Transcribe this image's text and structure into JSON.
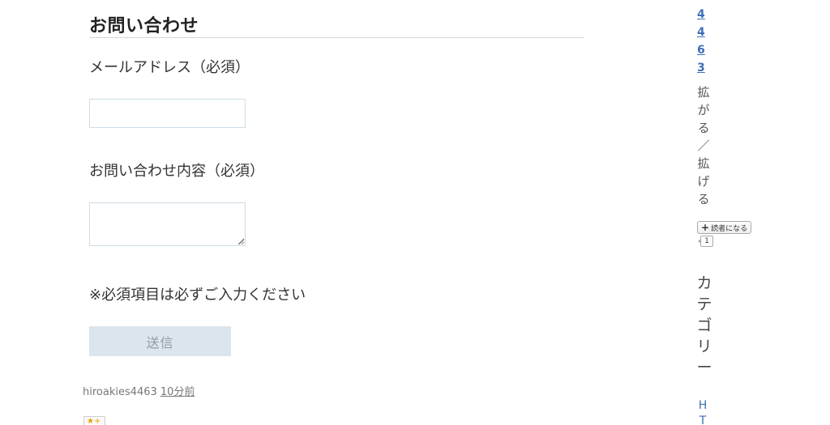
{
  "form": {
    "title": "お問い合わせ",
    "email_label": "メールアドレス（必須）",
    "email_value": "",
    "message_label": "お問い合わせ内容（必須）",
    "message_value": "",
    "required_note": "※必須項目は必ずご入力ください",
    "submit_label": "送信"
  },
  "meta": {
    "author": "hiroakies4463",
    "time": "10分前",
    "star_label": "★+"
  },
  "sidebar": {
    "stats": [
      "4",
      "4",
      "6",
      "3"
    ],
    "blog_title_chars": [
      "拡",
      "が",
      "る",
      "／",
      "拡",
      "げ",
      "る"
    ],
    "subscribe_label": "読者になる",
    "subscriber_count": "1",
    "category_heading_chars": [
      "カ",
      "テ",
      "ゴ",
      "リ",
      "ー"
    ],
    "category_first_chars": [
      "H",
      "T"
    ]
  },
  "colors": {
    "link": "#3f6fb5",
    "button_bg": "#dce5eb",
    "input_border": "#cfdde6"
  }
}
